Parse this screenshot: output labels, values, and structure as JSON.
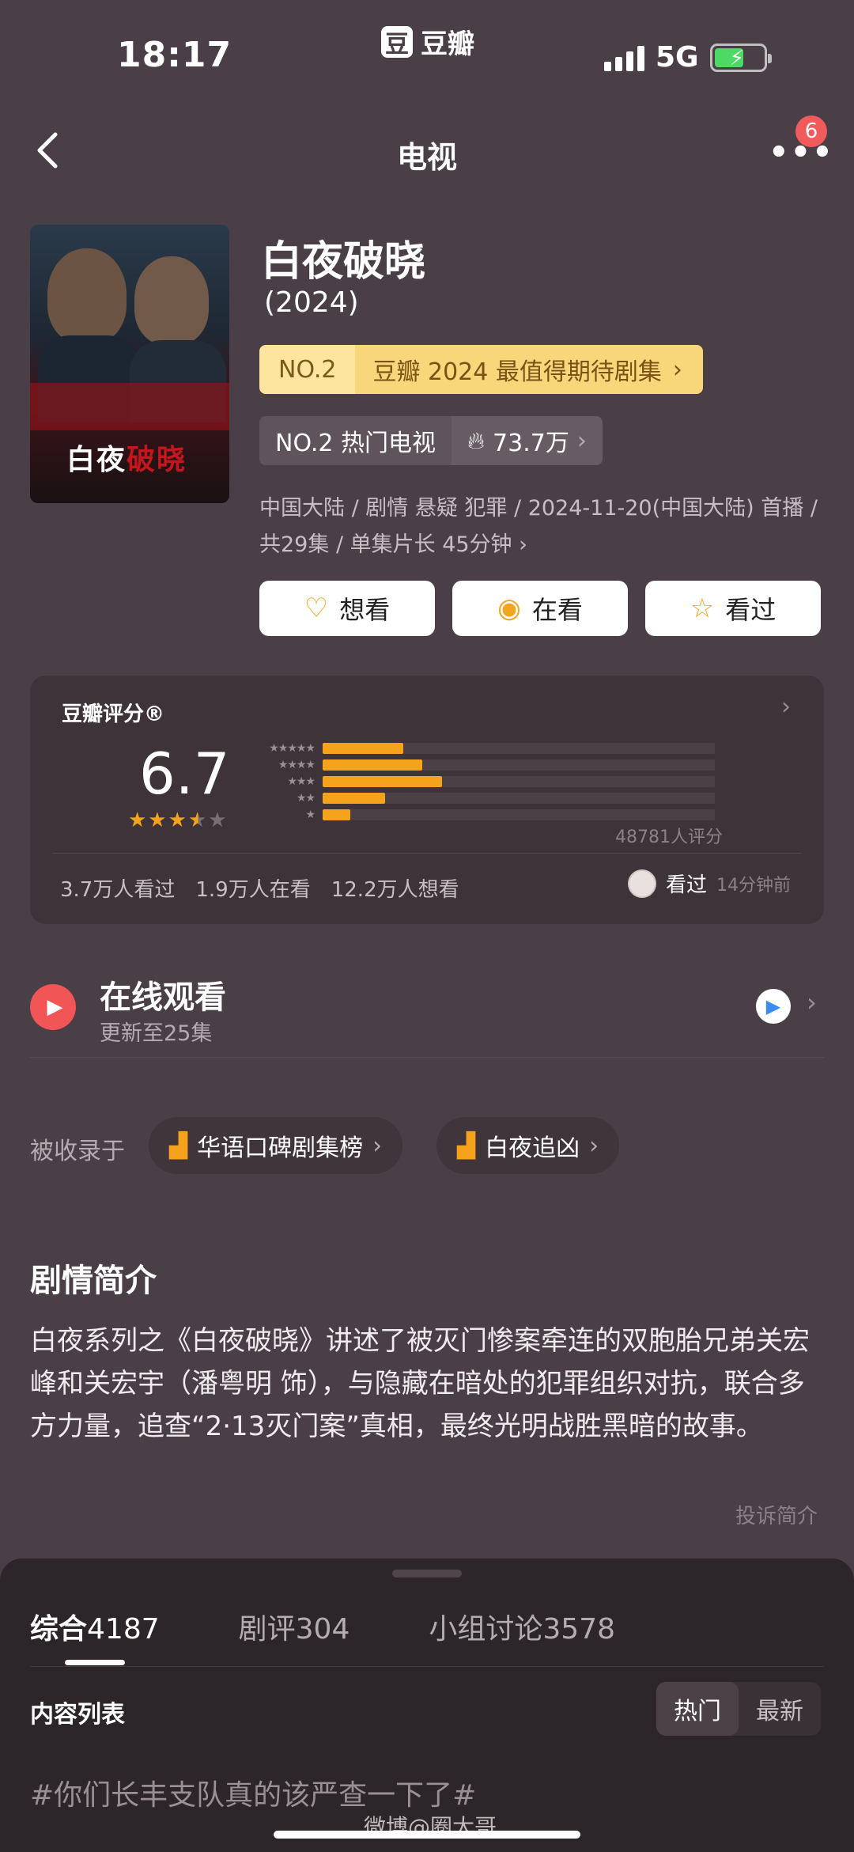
{
  "status_bar": {
    "time": "18:17",
    "app_logo": "豆",
    "app_name": "豆瓣",
    "network": "5G"
  },
  "nav": {
    "title": "电视",
    "badge_count": "6"
  },
  "poster": {
    "title_white": "白夜",
    "title_red": "破晓"
  },
  "show": {
    "title": "白夜破晓",
    "year": "(2024)",
    "rank_no": "NO.2",
    "rank_text": "豆瓣 2024 最值得期待剧集",
    "hot_no": "NO.2 热门电视",
    "hot_value": "73.7万",
    "meta_line1": "中国大陆 / 剧情 悬疑 犯罪 / 2024-11-20(中国大陆) 首播 /",
    "meta_line2": "共29集 / 单集片长 45分钟"
  },
  "actions": [
    {
      "label": "想看",
      "icon": "heart-plus-icon"
    },
    {
      "label": "在看",
      "icon": "target-icon"
    },
    {
      "label": "看过",
      "icon": "star-outline-icon"
    }
  ],
  "rating": {
    "label": "豆瓣评分®",
    "score": "6.7",
    "stars_filled": 3.5,
    "distribution_percent": [
      20.5,
      25.5,
      30.5,
      16,
      7
    ],
    "count_text": "48781人评分",
    "watched": "3.7万人看过",
    "watching": "1.9万人在看",
    "want": "12.2万人想看",
    "user_status": "看过",
    "user_time": "14分钟前"
  },
  "online": {
    "title": "在线观看",
    "subtitle": "更新至25集"
  },
  "collections": {
    "label": "被收录于",
    "items": [
      "华语口碑剧集榜",
      "白夜追凶"
    ]
  },
  "synopsis": {
    "title": "剧情简介",
    "text": "白夜系列之《白夜破晓》讲述了被灭门惨案牵连的双胞胎兄弟关宏峰和关宏宇（潘粤明 饰），与隐藏在暗处的犯罪组织对抗，联合多方力量，追查“2·13灭门案”真相，最终光明战胜黑暗的故事。",
    "report": "投诉简介"
  },
  "sheet": {
    "tabs": [
      {
        "label": "综合",
        "count": "4187"
      },
      {
        "label": "剧评",
        "count": "304"
      },
      {
        "label": "小组讨论",
        "count": "3578"
      }
    ],
    "list_label": "内容列表",
    "sort_hot": "热门",
    "sort_new": "最新",
    "post_preview": "#你们长丰支队真的该严查一下了#",
    "watermark": "微博@圈大哥"
  }
}
